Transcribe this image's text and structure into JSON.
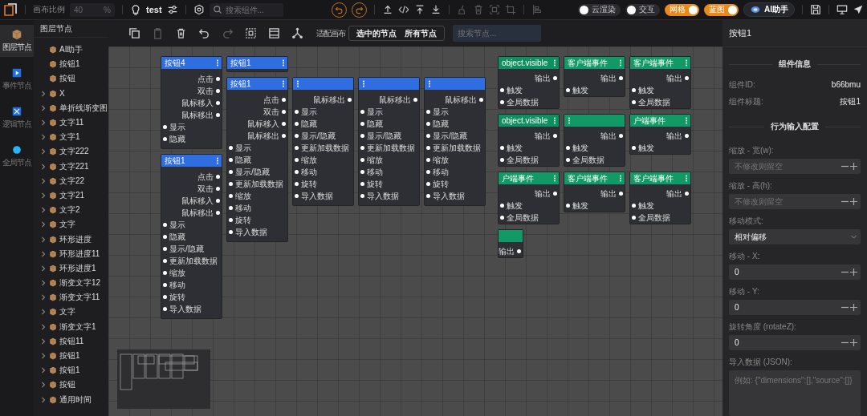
{
  "top_bar": {
    "scale_label": "画布比例",
    "scale_value": "40",
    "scale_unit": "%",
    "project": "test",
    "search_placeholder": "搜索组件...",
    "history": [
      {
        "kind": "undo",
        "disabled": false
      },
      {
        "kind": "redo",
        "disabled": false
      }
    ],
    "action_groups": [
      [
        {
          "kind": "upload",
          "disabled": false
        },
        {
          "kind": "code",
          "disabled": false
        },
        {
          "kind": "publish",
          "disabled": false
        },
        {
          "kind": "download",
          "disabled": false
        }
      ],
      [
        {
          "kind": "clear",
          "disabled": true
        },
        {
          "kind": "delete",
          "disabled": true
        },
        {
          "kind": "fit",
          "disabled": true
        },
        {
          "kind": "crop",
          "disabled": true
        }
      ],
      [
        {
          "kind": "align",
          "disabled": true
        }
      ]
    ],
    "toggles": [
      {
        "label": "云渲染",
        "on": false
      },
      {
        "label": "交互",
        "on": false
      },
      {
        "label": "网格",
        "on": true
      },
      {
        "label": "蓝图",
        "on": true
      }
    ],
    "ai_button": "AI助手"
  },
  "rail": [
    {
      "kind": "layers",
      "label": "图层节点",
      "selected": true
    },
    {
      "kind": "event",
      "label": "事件节点",
      "selected": false
    },
    {
      "kind": "logic",
      "label": "逻辑节点",
      "selected": false
    },
    {
      "kind": "global",
      "label": "全局节点",
      "selected": false
    }
  ],
  "layers": {
    "title": "图层节点",
    "items": [
      {
        "label": "AI助手"
      },
      {
        "label": "按钮1"
      },
      {
        "label": "按钮"
      },
      {
        "label": "X",
        "expanded": false
      },
      {
        "label": "单折线渐变图",
        "expanded": false
      },
      {
        "label": "文字11",
        "expanded": false
      },
      {
        "label": "文字1",
        "expanded": false
      },
      {
        "label": "文字222",
        "expanded": false
      },
      {
        "label": "文字221",
        "expanded": false
      },
      {
        "label": "文字22",
        "expanded": false
      },
      {
        "label": "文字21",
        "expanded": false
      },
      {
        "label": "文字2",
        "expanded": false
      },
      {
        "label": "文字",
        "expanded": false
      },
      {
        "label": "环形进度",
        "expanded": false
      },
      {
        "label": "环形进度11",
        "expanded": false
      },
      {
        "label": "环形进度1",
        "expanded": false
      },
      {
        "label": "渐变文字12",
        "expanded": false
      },
      {
        "label": "渐变文字11",
        "expanded": false
      },
      {
        "label": "文字",
        "expanded": false
      },
      {
        "label": "渐变文字1",
        "expanded": false
      },
      {
        "label": "按钮11",
        "expanded": false
      },
      {
        "label": "按钮1",
        "expanded": false
      },
      {
        "label": "按钮1",
        "expanded": false
      },
      {
        "label": "按钮",
        "expanded": false
      },
      {
        "label": "通用时间",
        "expanded": false
      }
    ]
  },
  "canvas_toolbar": {
    "tools": [
      {
        "kind": "copy",
        "disabled": false
      },
      {
        "kind": "paste",
        "disabled": true
      },
      {
        "kind": "delete",
        "disabled": false
      },
      {
        "kind": "undo",
        "disabled": false
      },
      {
        "kind": "redo",
        "disabled": true
      },
      {
        "kind": "select",
        "disabled": false
      },
      {
        "kind": "layout",
        "disabled": false
      },
      {
        "kind": "network",
        "disabled": false
      }
    ],
    "fit_label": "适配画布",
    "fit_options": [
      "选中的节点",
      "所有节点"
    ],
    "search_placeholder": "搜索节点..."
  },
  "graph": {
    "nodes": [
      {
        "kind": "component",
        "title": "按钮4",
        "outputs": [
          "点击",
          "双击",
          "鼠标移入",
          "鼠标移出"
        ],
        "inputs": [
          "显示",
          "隐藏"
        ]
      },
      {
        "kind": "component",
        "title": "按钮1",
        "outputs": [
          "点击",
          "双击",
          "鼠标移入",
          "鼠标移出"
        ],
        "inputs": [
          "显示",
          "隐藏",
          "显示/隐藏",
          "更新加载数据",
          "缩放",
          "移动",
          "旋转",
          "导入数据"
        ]
      },
      {
        "kind": "component",
        "title": "按钮1"
      },
      {
        "kind": "component",
        "title": "按钮1",
        "outputs": [
          "点击",
          "双击",
          "鼠标移入",
          "鼠标移出"
        ],
        "inputs": [
          "显示",
          "隐藏",
          "显示/隐藏",
          "更新加载数据",
          "缩放",
          "移动",
          "旋转",
          "导入数据"
        ]
      },
      {
        "kind": "component",
        "outputs": [
          "鼠标移出"
        ],
        "inputs": [
          "显示",
          "隐藏",
          "显示/隐藏",
          "更新加载数据",
          "缩放",
          "移动",
          "旋转",
          "导入数据"
        ]
      },
      {
        "kind": "component",
        "outputs": [
          "鼠标移出"
        ],
        "inputs": [
          "显示",
          "隐藏",
          "显示/隐藏",
          "更新加载数据",
          "缩放",
          "移动",
          "旋转",
          "导入数据"
        ]
      },
      {
        "kind": "component",
        "outputs": [
          "鼠标移出"
        ],
        "inputs": [
          "显示",
          "隐藏",
          "显示/隐藏",
          "更新加载数据",
          "缩放",
          "移动",
          "旋转",
          "导入数据"
        ]
      },
      {
        "kind": "action",
        "title": "object.visible",
        "outputs": [
          "输出"
        ],
        "inputs": [
          "触发",
          "全局数据"
        ]
      },
      {
        "kind": "event",
        "title": "客户端事件",
        "outputs": [
          "输出"
        ],
        "inputs": [
          "触发"
        ]
      },
      {
        "kind": "event",
        "title": "客户端事件",
        "outputs": [
          "输出"
        ],
        "inputs": [
          "触发",
          "全局数据"
        ]
      },
      {
        "kind": "action",
        "title": "object.visible",
        "outputs": [
          "输出"
        ],
        "inputs": [
          "触发",
          "全局数据"
        ]
      },
      {
        "kind": "event",
        "outputs": [
          "输出"
        ],
        "inputs": [
          "触发",
          "全局数据"
        ]
      },
      {
        "kind": "event",
        "title": "户端事件",
        "outputs": [
          "输出"
        ],
        "inputs": [
          "触发"
        ]
      },
      {
        "kind": "event",
        "title": "户端事件",
        "outputs": [
          "输出"
        ],
        "inputs": [
          "触发",
          "全局数据"
        ]
      },
      {
        "kind": "event",
        "title": "客户端事件",
        "outputs": [
          "输出"
        ],
        "inputs": [
          "触发"
        ]
      },
      {
        "kind": "event",
        "title": "客户端事件",
        "outputs": [
          "输出"
        ],
        "inputs": [
          "触发",
          "全局数据"
        ]
      },
      {
        "kind": "event",
        "outputs": [
          "输出"
        ]
      }
    ]
  },
  "inspector": {
    "title": "按钮1",
    "info_heading": "组件信息",
    "info": [
      {
        "label": "组件ID:",
        "value": "b66bmu"
      },
      {
        "label": "组件标题:",
        "value": "按钮1"
      }
    ],
    "config_heading": "行为输入配置",
    "fields": [
      {
        "kind": "number",
        "label": "缩放 - 宽(w):",
        "placeholder": "不修改则留空"
      },
      {
        "kind": "number",
        "label": "缩放 - 高(h):",
        "placeholder": "不修改则留空"
      },
      {
        "kind": "select",
        "label": "移动模式:",
        "value": "相对偏移"
      },
      {
        "kind": "number",
        "label": "移动 - X:",
        "value": "0"
      },
      {
        "kind": "number",
        "label": "移动 - Y:",
        "value": "0"
      },
      {
        "kind": "number",
        "label": "旋转角度 (rotateZ):",
        "value": "0"
      },
      {
        "kind": "textarea",
        "label": "导入数据 (JSON):",
        "placeholder": "例如: {\"dimensions\":[],\"source\":[]}"
      }
    ]
  }
}
